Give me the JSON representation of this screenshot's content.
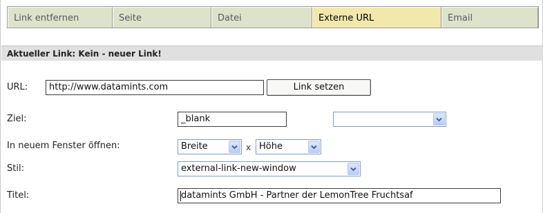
{
  "tabs": [
    {
      "label": "Link entfernen",
      "active": false
    },
    {
      "label": "Seite",
      "active": false
    },
    {
      "label": "Datei",
      "active": false
    },
    {
      "label": "Externe URL",
      "active": true
    },
    {
      "label": "Email",
      "active": false
    }
  ],
  "heading": "Aktueller Link: Kein - neuer Link!",
  "url": {
    "label": "URL:",
    "value": "http://www.datamints.com",
    "button": "Link setzen"
  },
  "target": {
    "label": "Ziel:",
    "value": "_blank",
    "select_value": ""
  },
  "new_window": {
    "label": "In neuem Fenster öffnen:",
    "width_option": "Breite",
    "times": "x",
    "height_option": "Höhe"
  },
  "style": {
    "label": "Stil:",
    "value": "external-link-new-window"
  },
  "title": {
    "label": "Titel:",
    "value": "datamints GmbH - Partner der LemonTree Fruchtsaf"
  },
  "colors": {
    "tab_bg": "#dde3ca",
    "tab_active_bg": "#f1e8ac",
    "heading_bg": "#e0e0e0",
    "dropdown_arrow": "#4d6185"
  },
  "icons": {
    "dropdown": "chevron-down-icon"
  }
}
